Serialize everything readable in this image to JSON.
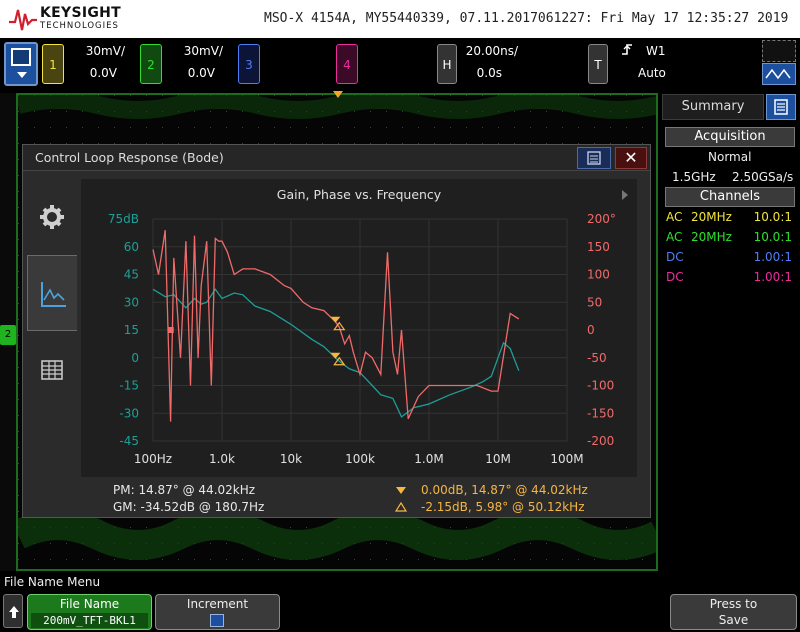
{
  "header": {
    "brand": "KEYSIGHT",
    "brand_sub": "TECHNOLOGIES",
    "model_line": "MSO-X 4154A, MY55440339, 07.11.2017061227: Fri May 17 12:35:27 2019"
  },
  "channels": [
    {
      "number": "1",
      "scale": "30mV/",
      "offset": "0.0V",
      "color": "#f2e33a"
    },
    {
      "number": "2",
      "scale": "30mV/",
      "offset": "0.0V",
      "color": "#2ee02e"
    },
    {
      "number": "3",
      "scale": "",
      "offset": "",
      "color": "#4f7df5"
    },
    {
      "number": "4",
      "scale": "",
      "offset": "",
      "color": "#ec2d9c"
    }
  ],
  "horizontal": {
    "label": "H",
    "timebase": "20.00ns/",
    "delay": "0.0s"
  },
  "trigger": {
    "label": "T",
    "source": "W1",
    "mode": "Auto"
  },
  "ch2_marker": "2",
  "sidebar": {
    "summary_tab": "Summary",
    "acquisition_header": "Acquisition",
    "acq_mode": "Normal",
    "bandwidth": "1.5GHz",
    "sample_rate": "2.50GSa/s",
    "channels_header": "Channels",
    "channel_rows": [
      {
        "coupling": "AC",
        "bw": "20MHz",
        "probe": "10.0:1",
        "color": "#f2e33a"
      },
      {
        "coupling": "AC",
        "bw": "20MHz",
        "probe": "10.0:1",
        "color": "#2ee02e"
      },
      {
        "coupling": "DC",
        "bw": "",
        "probe": "1.00:1",
        "color": "#4f7df5"
      },
      {
        "coupling": "DC",
        "bw": "",
        "probe": "1.00:1",
        "color": "#ec2d9c"
      }
    ]
  },
  "dialog": {
    "title": "Control Loop Response (Bode)",
    "close_glyph": "✕",
    "pm_line": "PM:  14.87° @ 44.02kHz",
    "gm_line": "GM:  -34.52dB @ 180.7Hz",
    "cursor1_line": "0.00dB, 14.87° @ 44.02kHz",
    "cursor2_line": "-2.15dB, 5.98° @ 50.12kHz"
  },
  "chart_data": {
    "type": "line",
    "title": "Gain, Phase vs. Frequency",
    "x_scale": "log",
    "x_ticks": [
      "100Hz",
      "1.0k",
      "10k",
      "100k",
      "1.0M",
      "10M",
      "100M"
    ],
    "x_tick_values": [
      100,
      1000,
      10000,
      100000,
      1000000,
      10000000,
      100000000
    ],
    "xlim": [
      100,
      100000000
    ],
    "y_left_ticks": [
      "75dB",
      "60",
      "45",
      "30",
      "15",
      "0",
      "-15",
      "-30",
      "-45"
    ],
    "ylim_left": [
      -45,
      75
    ],
    "y_right_ticks": [
      "200°",
      "150",
      "100",
      "50",
      "0",
      "-50",
      "-100",
      "-150",
      "-200"
    ],
    "ylim_right": [
      -200,
      200
    ],
    "grid": true,
    "series": [
      {
        "axis": "left",
        "color": "#1e9e98",
        "x": [
          100,
          150,
          200,
          300,
          400,
          500,
          600,
          800,
          1000,
          1500,
          2000,
          3000,
          5000,
          10000,
          20000,
          30000,
          44020,
          50120,
          70000,
          100000,
          150000,
          200000,
          300000,
          400000,
          600000,
          1000000,
          2000000,
          4000000,
          6000000,
          8000000,
          10000000,
          12000000,
          15000000,
          20000000
        ],
        "y": [
          37,
          33,
          34,
          27,
          32,
          29,
          30,
          37,
          32,
          35,
          34,
          28,
          25,
          18,
          10,
          6,
          0,
          -2,
          -6,
          -8,
          -15,
          -20,
          -22,
          -32,
          -27,
          -25,
          -20,
          -16,
          -13,
          -10,
          0,
          8,
          5,
          -7
        ]
      },
      {
        "axis": "right",
        "color": "#f06a6a",
        "x": [
          100,
          120,
          150,
          180,
          200,
          250,
          300,
          350,
          400,
          450,
          500,
          600,
          700,
          800,
          900,
          1000,
          1200,
          1500,
          2000,
          3000,
          5000,
          8000,
          10000,
          15000,
          20000,
          30000,
          44020,
          50120,
          60000,
          70000,
          80000,
          100000,
          120000,
          150000,
          200000,
          250000,
          300000,
          350000,
          400000,
          500000,
          700000,
          1000000,
          2000000,
          5000000,
          8000000,
          10000000,
          15000000,
          20000000
        ],
        "y": [
          145,
          100,
          180,
          -165,
          130,
          -50,
          160,
          -100,
          170,
          -50,
          80,
          160,
          -100,
          165,
          160,
          160,
          140,
          100,
          110,
          110,
          100,
          80,
          75,
          50,
          40,
          35,
          15,
          5,
          -25,
          -10,
          -40,
          -80,
          -40,
          -50,
          -80,
          140,
          -40,
          -80,
          0,
          -160,
          -120,
          -100,
          -100,
          -100,
          -110,
          -110,
          30,
          20
        ]
      }
    ],
    "markers": [
      {
        "x": 44020,
        "axis": "right",
        "value": 14.87
      },
      {
        "x": 44020,
        "axis": "left",
        "value": 0.0
      },
      {
        "x": 50120,
        "axis": "right",
        "value": 5.98
      },
      {
        "x": 50120,
        "axis": "left",
        "value": -2.15
      }
    ],
    "gm_marker": {
      "x": 180.7,
      "axis": "left",
      "value": 15
    }
  },
  "bottom": {
    "menu_label": "File Name Menu",
    "file_name_label": "File Name",
    "file_name_value": "200mV_TFT-BKL1",
    "increment_label": "Increment",
    "press_to_save_line1": "Press to",
    "press_to_save_line2": "Save"
  }
}
